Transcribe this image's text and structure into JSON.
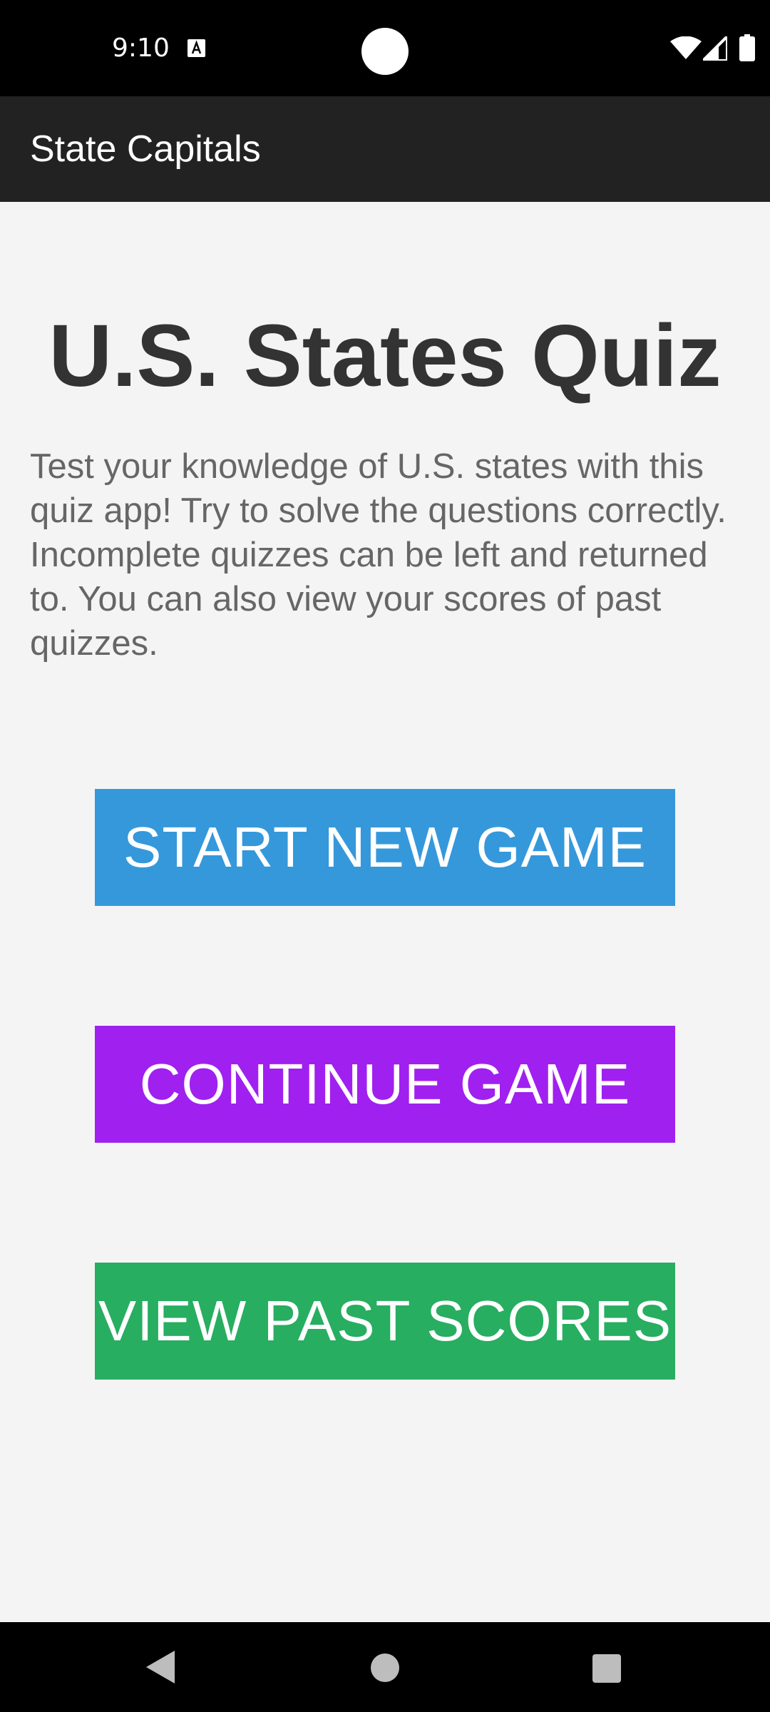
{
  "status_bar": {
    "time": "9:10",
    "icons": [
      "text-a-icon",
      "wifi-icon",
      "signal-icon",
      "battery-icon"
    ]
  },
  "app_bar": {
    "title": "State Capitals",
    "background": "#222222"
  },
  "main": {
    "heading": "U.S. States Quiz",
    "description": "Test your knowledge of U.S. states with this quiz app! Try to solve the questions correctly. Incomplete quizzes can be left and returned to. You can also view your scores of past quizzes.",
    "background": "#f4f4f4",
    "buttons": {
      "start_new_game": {
        "label": "START NEW GAME",
        "color": "#3598db"
      },
      "continue_game": {
        "label": "CONTINUE GAME",
        "color": "#a020f0"
      },
      "view_past_scores": {
        "label": "VIEW PAST SCORES",
        "color": "#27ae60"
      }
    }
  },
  "nav_bar": {
    "icons": [
      "back-icon",
      "home-icon",
      "recents-icon"
    ]
  }
}
